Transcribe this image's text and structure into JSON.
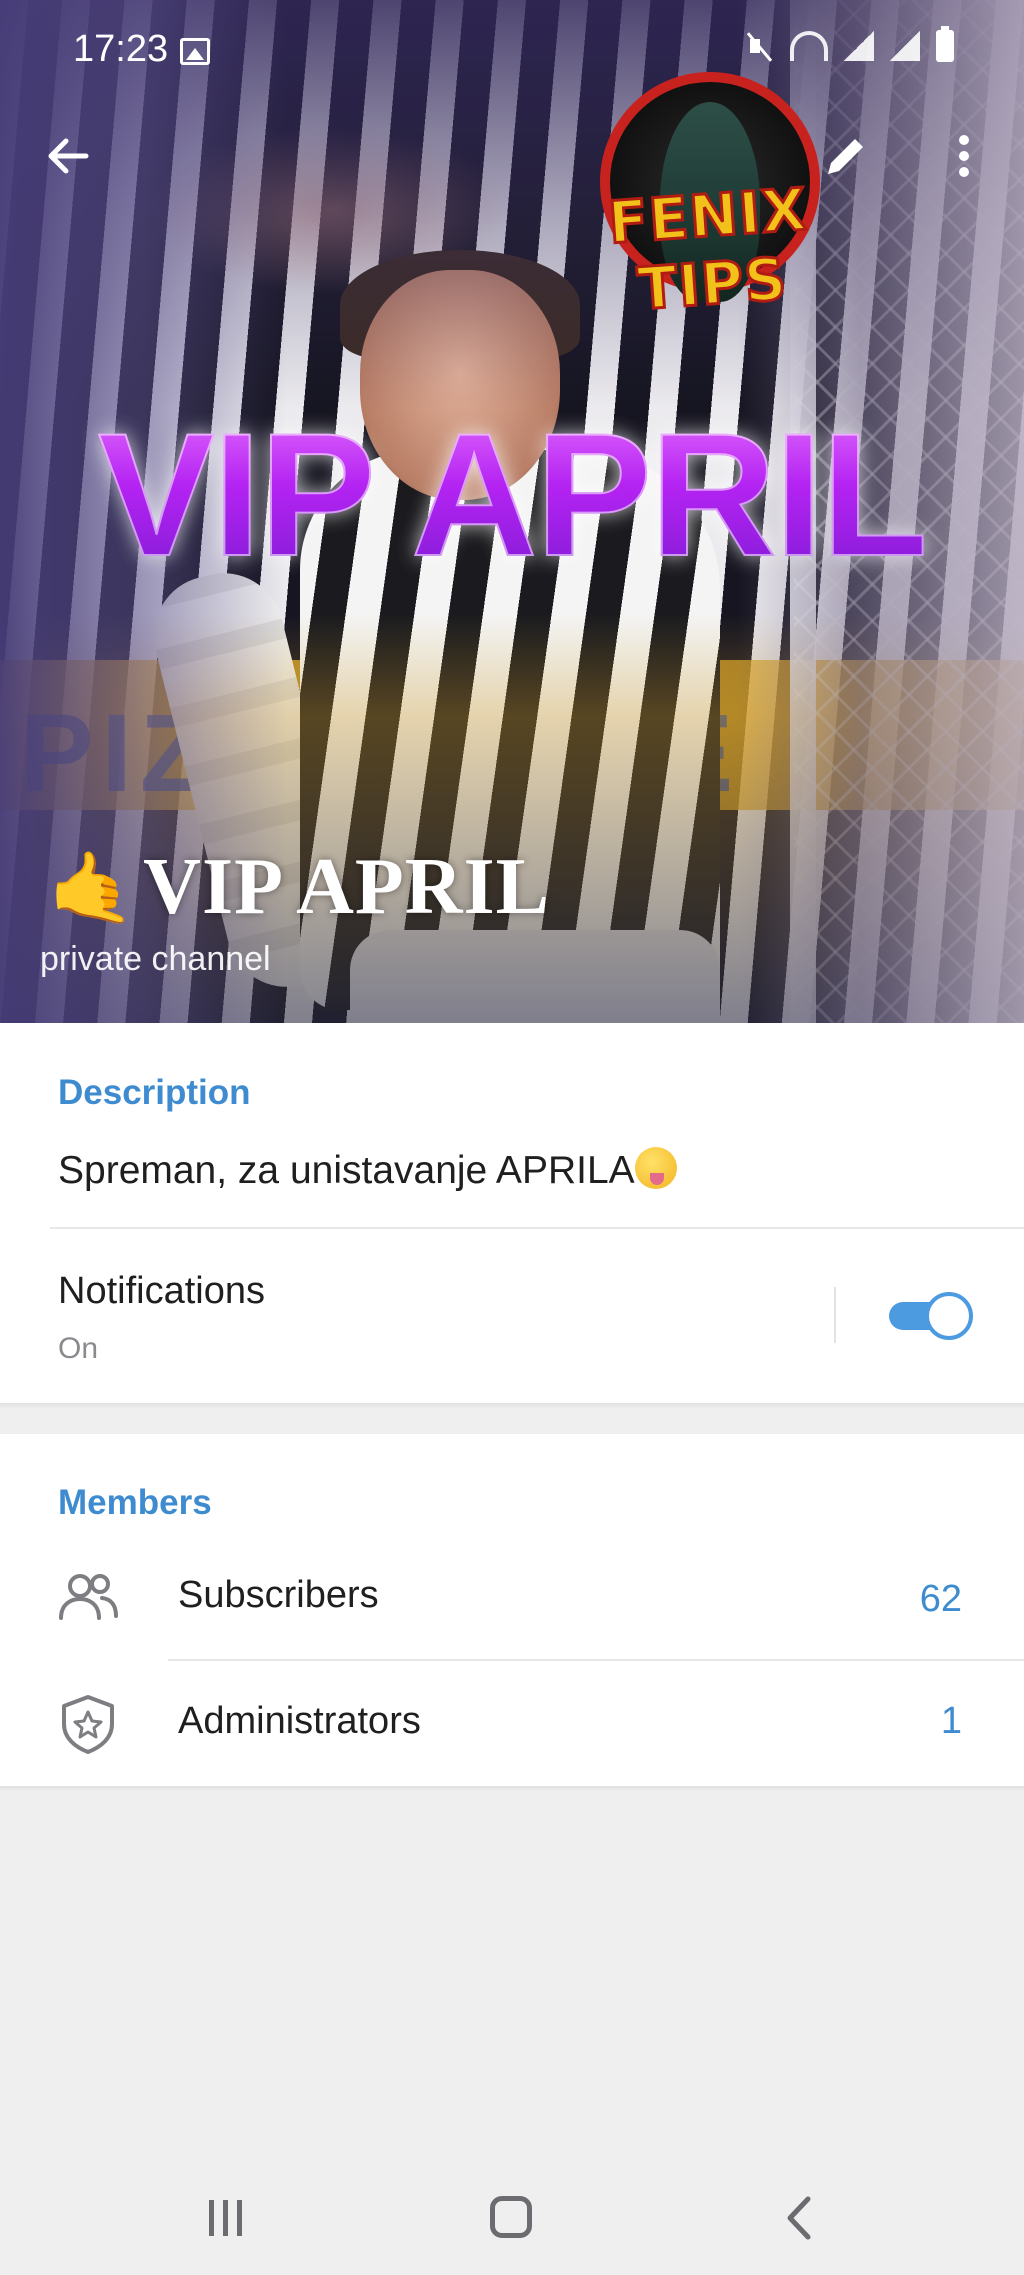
{
  "status_bar": {
    "time": "17:23",
    "icons": [
      "gallery-icon",
      "mute-icon",
      "wifi-icon",
      "signal-icon",
      "signal-icon",
      "battery-icon"
    ]
  },
  "cover": {
    "artwork_text": "VIP APRIL",
    "logo_text": "FENIX TIPS"
  },
  "header": {
    "back_icon": "arrow-left-icon",
    "edit_icon": "pencil-icon",
    "more_icon": "more-vertical-icon"
  },
  "channel": {
    "emoji": "🤙",
    "name": "VIP APRIL",
    "type": "private channel"
  },
  "info": {
    "description_label": "Description",
    "description_text": "Spreman, za unistavanje APRILA",
    "notifications_label": "Notifications",
    "notifications_status": "On",
    "notifications_enabled": true
  },
  "members": {
    "section_label": "Members",
    "rows": [
      {
        "label": "Subscribers",
        "count": "62",
        "icon": "people-icon"
      },
      {
        "label": "Administrators",
        "count": "1",
        "icon": "shield-star-icon"
      }
    ]
  },
  "colors": {
    "accent": "#3e8bd0",
    "toggle_on": "#4c9ae0",
    "background": "#efeff0"
  },
  "nav_bar": {
    "icons": [
      "recent-apps-icon",
      "home-icon",
      "back-icon"
    ]
  }
}
